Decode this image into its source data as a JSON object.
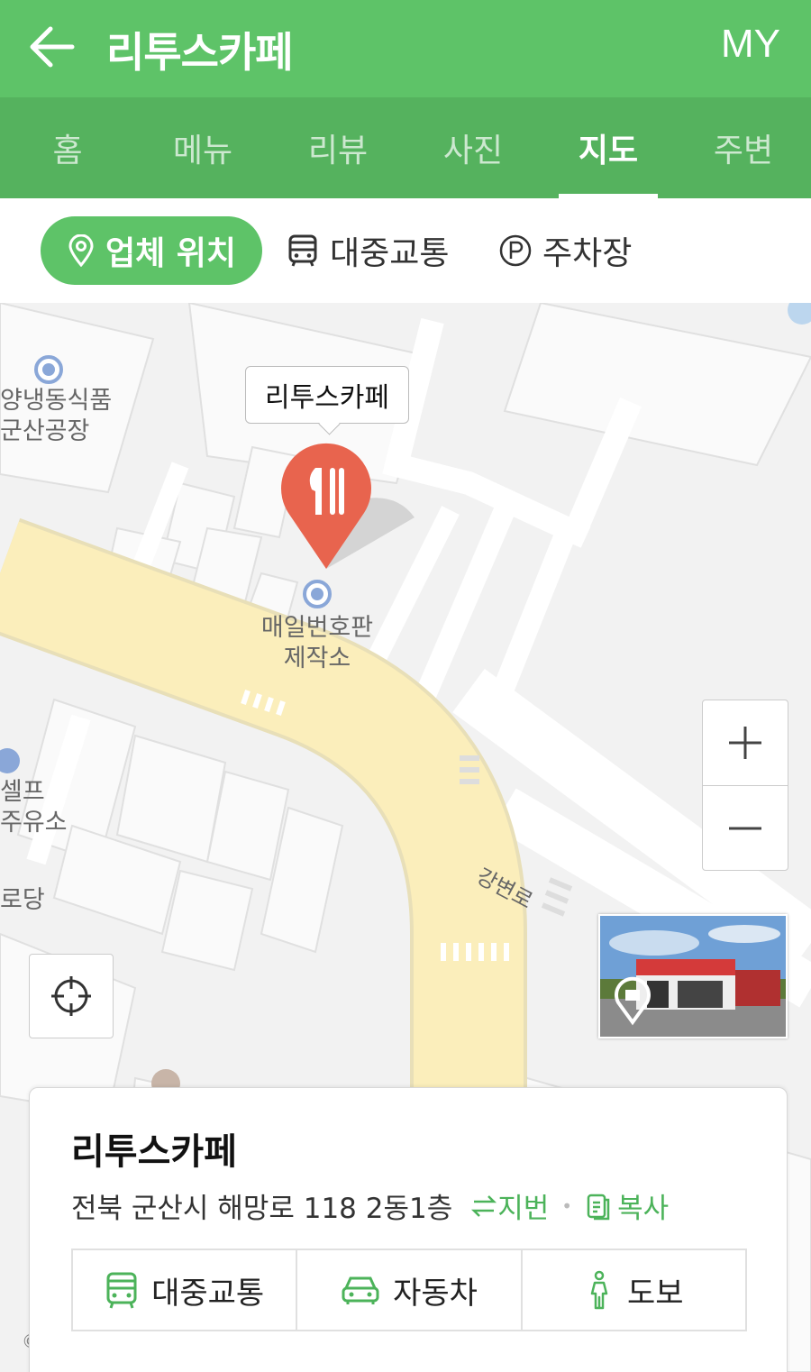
{
  "header": {
    "title": "리투스카페",
    "my_label": "MY"
  },
  "tabs": [
    {
      "label": "홈"
    },
    {
      "label": "메뉴"
    },
    {
      "label": "리뷰"
    },
    {
      "label": "사진"
    },
    {
      "label": "지도",
      "active": true
    },
    {
      "label": "주변"
    }
  ],
  "subtabs": {
    "location": "업체 위치",
    "transit": "대중교통",
    "parking": "주차장"
  },
  "map": {
    "callout": "리투스카페",
    "poi_1_line1": "양냉동식품",
    "poi_1_line2": "군산공장",
    "poi_2_line1": "매일번호판",
    "poi_2_line2": "제작소",
    "poi_3_line1": "셀프",
    "poi_3_line2": "주유소",
    "poi_4": "로당",
    "road": "강변로",
    "zoom_in": "+",
    "zoom_out": "—"
  },
  "card": {
    "name": "리투스카페",
    "address": "전북 군산시 해망로 118 2동1층",
    "jibun_label": "지번",
    "copy_label": "복사",
    "routes": {
      "transit": "대중교통",
      "car": "자동차",
      "walk": "도보"
    }
  },
  "colors": {
    "brand_green": "#5ec368",
    "tab_green": "#55b25e",
    "pin": "#e8644e",
    "road": "#fbeebb"
  }
}
